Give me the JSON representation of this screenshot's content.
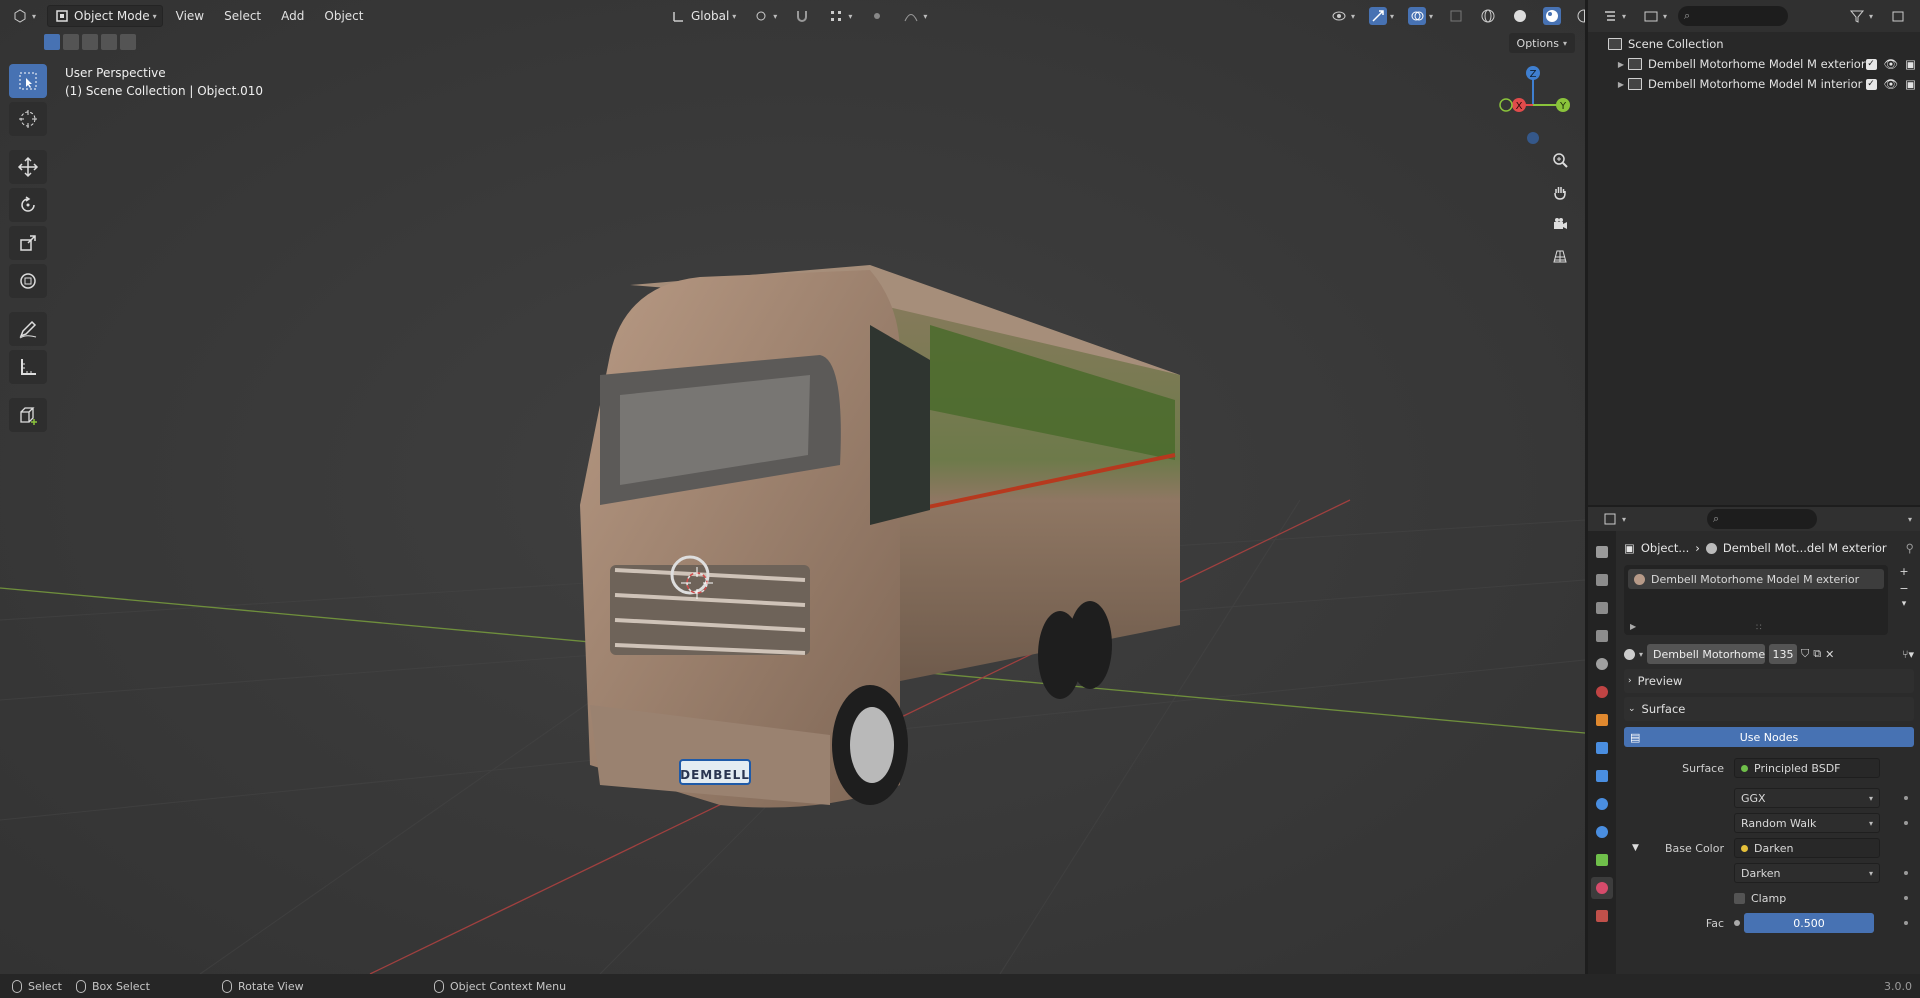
{
  "header": {
    "mode": "Object Mode",
    "menus": [
      "View",
      "Select",
      "Add",
      "Object"
    ],
    "orientation": "Global",
    "options": "Options"
  },
  "viewport": {
    "line1": "User Perspective",
    "line2": "(1) Scene Collection | Object.010",
    "plate_text": "DEMBELL"
  },
  "gizmo": {
    "z": "Z",
    "x": "X",
    "y": "Y"
  },
  "outliner": {
    "root": "Scene Collection",
    "items": [
      {
        "label": "Dembell Motorhome Model M exterior"
      },
      {
        "label": "Dembell Motorhome Model M  interior"
      }
    ]
  },
  "properties": {
    "breadcrumb_object": "Object...",
    "breadcrumb_material": "Dembell Mot...del M exterior",
    "slot_label": "Dembell Motorhome Model M exterior",
    "material_name": "Dembell Motorhome ...",
    "user_count": "135",
    "preview_label": "Preview",
    "surface_panel": "Surface",
    "use_nodes": "Use Nodes",
    "rows": {
      "surface_label": "Surface",
      "surface_value": "Principled BSDF",
      "distribution": "GGX",
      "subsurface": "Random Walk",
      "base_color_label": "Base Color",
      "base_color_value": "Darken",
      "blend_mode": "Darken",
      "clamp": "Clamp",
      "fac_label": "Fac",
      "fac_value": "0.500"
    }
  },
  "statusbar": {
    "select": "Select",
    "box_select": "Box Select",
    "rotate": "Rotate View",
    "context": "Object Context Menu",
    "version": "3.0.0"
  },
  "colors": {
    "accent": "#4772b3",
    "axis_x": "#e04b4b",
    "axis_y": "#8ac33b",
    "axis_z": "#3f7fd0",
    "truck_body": "#9c7f6a"
  }
}
